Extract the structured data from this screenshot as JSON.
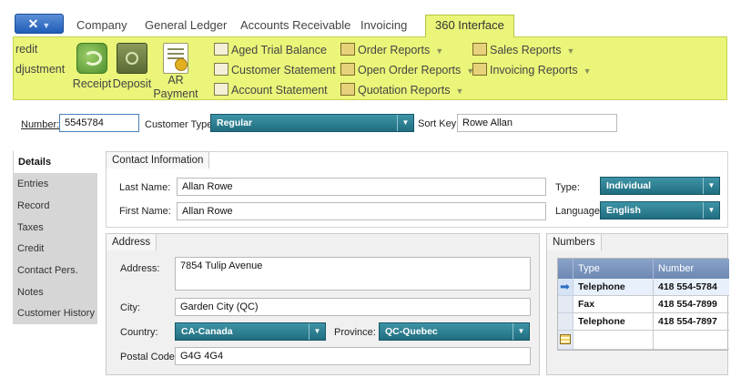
{
  "tabs": {
    "items": [
      "Company",
      "General Ledger",
      "Accounts Receivable",
      "Invoicing",
      "360 Interface"
    ],
    "active": "360 Interface"
  },
  "ribbon": {
    "partial_labels": [
      "redit",
      "djustment"
    ],
    "big_buttons": [
      {
        "label": "Receipt",
        "icon": "receipt-icon"
      },
      {
        "label": "Deposit",
        "icon": "deposit-safe-icon"
      },
      {
        "label_line1": "AR",
        "label_line2": "Payment",
        "icon": "ar-payment-icon"
      }
    ],
    "reports_col1": [
      "Aged Trial Balance",
      "Customer Statement",
      "Account Statement"
    ],
    "reports_col2": [
      "Order Reports",
      "Open Order Reports",
      "Quotation Reports"
    ],
    "reports_col3": [
      "Sales Reports",
      "Invoicing Reports"
    ]
  },
  "header": {
    "number_label": "Number:",
    "number_value": "5545784",
    "customer_type_label": "Customer Type:",
    "customer_type_value": "Regular",
    "sort_key_label": "Sort Key:",
    "sort_key_value": "Rowe Allan"
  },
  "nav": {
    "items": [
      "Details",
      "Entries",
      "Record",
      "Taxes",
      "Credit",
      "Contact Pers.",
      "Notes",
      "Customer History"
    ],
    "active": "Details"
  },
  "contact": {
    "title": "Contact Information",
    "last_name_label": "Last Name:",
    "last_name": "Allan Rowe",
    "first_name_label": "First Name:",
    "first_name": "Allan Rowe",
    "type_label": "Type:",
    "type_value": "Individual",
    "language_label": "Language:",
    "language_value": "English"
  },
  "address": {
    "title": "Address",
    "address_label": "Address:",
    "address_value": "7854 Tulip Avenue",
    "city_label": "City:",
    "city_value": "Garden City (QC)",
    "country_label": "Country:",
    "country_value": "CA-Canada",
    "province_label": "Province:",
    "province_value": "QC-Quebec",
    "postal_label": "Postal Code:",
    "postal_value": "G4G 4G4"
  },
  "numbers": {
    "title": "Numbers",
    "columns": [
      "Type",
      "Number"
    ],
    "rows": [
      {
        "type": "Telephone",
        "number": "418 554-5784"
      },
      {
        "type": "Fax",
        "number": "418 554-7899"
      },
      {
        "type": "Telephone",
        "number": "418 554-7897"
      }
    ]
  },
  "colors": {
    "ribbon": "#eaf579",
    "combo": "#2a7f92",
    "grid_header": "#7b94bd"
  }
}
